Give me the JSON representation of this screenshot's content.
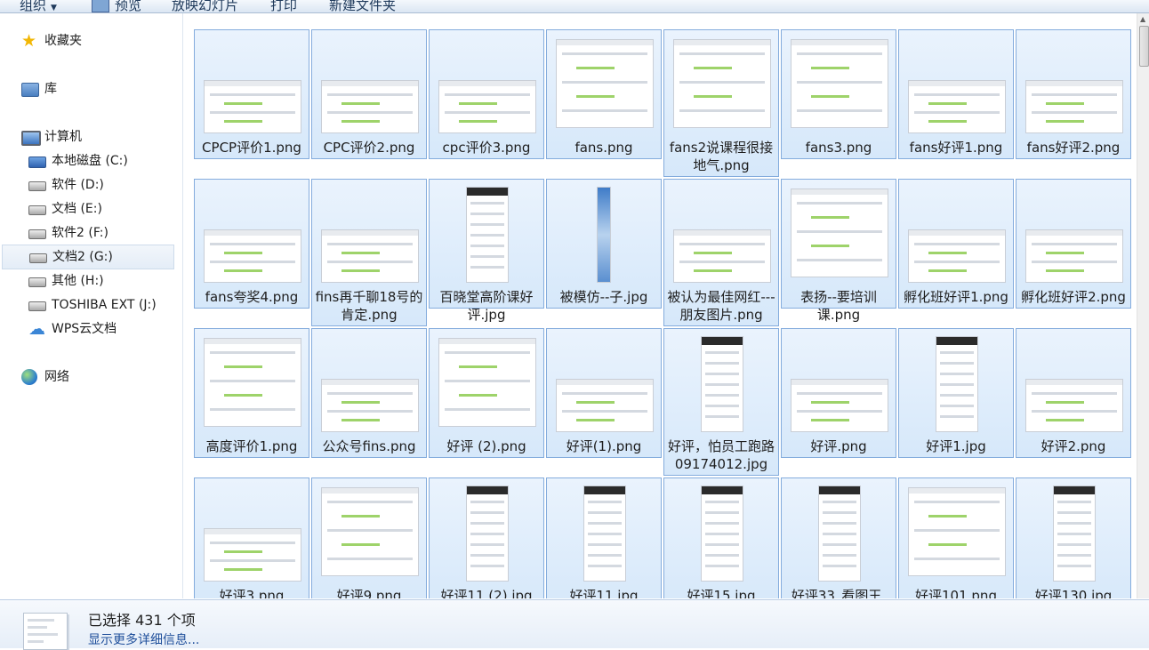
{
  "toolbar": {
    "organize": "组织",
    "preview": "预览",
    "slideshow": "放映幻灯片",
    "print": "打印",
    "new_folder": "新建文件夹"
  },
  "nav": {
    "favorites": "收藏夹",
    "libraries": "库",
    "computer": "计算机",
    "drives": [
      {
        "label": "本地磁盘 (C:)",
        "icon": "system-drive-icon"
      },
      {
        "label": "软件 (D:)",
        "icon": "drive-icon"
      },
      {
        "label": "文档 (E:)",
        "icon": "drive-icon"
      },
      {
        "label": "软件2 (F:)",
        "icon": "drive-icon"
      },
      {
        "label": "文档2 (G:)",
        "icon": "drive-icon",
        "selected": true
      },
      {
        "label": "其他 (H:)",
        "icon": "drive-icon"
      },
      {
        "label": "TOSHIBA EXT (J:)",
        "icon": "drive-icon"
      },
      {
        "label": "WPS云文档",
        "icon": "cloud-icon"
      }
    ],
    "network": "网络"
  },
  "files": [
    {
      "name": "CPCP评价1.png",
      "kind": "wide"
    },
    {
      "name": "CPC评价2.png",
      "kind": "wide"
    },
    {
      "name": "cpc评价3.png",
      "kind": "wide"
    },
    {
      "name": "fans.png",
      "kind": "chat"
    },
    {
      "name": "fans2说课程很接地气.png",
      "kind": "chat"
    },
    {
      "name": "fans3.png",
      "kind": "chat"
    },
    {
      "name": "fans好评1.png",
      "kind": "wide"
    },
    {
      "name": "fans好评2.png",
      "kind": "wide"
    },
    {
      "name": "fans夸奖4.png",
      "kind": "wide"
    },
    {
      "name": "fins再千聊18号的肯定.png",
      "kind": "wide"
    },
    {
      "name": "百晓堂高阶课好评.jpg",
      "kind": "phone"
    },
    {
      "name": "被模仿--子.jpg",
      "kind": "strip"
    },
    {
      "name": "被认为最佳网红---朋友图片.png",
      "kind": "wide"
    },
    {
      "name": "表扬--要培训课.png",
      "kind": "chat"
    },
    {
      "name": "孵化班好评1.png",
      "kind": "wide"
    },
    {
      "name": "孵化班好评2.png",
      "kind": "wide"
    },
    {
      "name": "高度评价1.png",
      "kind": "chat"
    },
    {
      "name": "公众号fins.png",
      "kind": "wide"
    },
    {
      "name": "好评 (2).png",
      "kind": "chat"
    },
    {
      "name": "好评(1).png",
      "kind": "wide"
    },
    {
      "name": "好评，怕员工跑路09174012.jpg",
      "kind": "phone"
    },
    {
      "name": "好评.png",
      "kind": "wide"
    },
    {
      "name": "好评1.jpg",
      "kind": "phone"
    },
    {
      "name": "好评2.png",
      "kind": "wide"
    },
    {
      "name": "好评3.png",
      "kind": "wide"
    },
    {
      "name": "好评9.png",
      "kind": "chat"
    },
    {
      "name": "好评11 (2).jpg",
      "kind": "phone"
    },
    {
      "name": "好评11.jpg",
      "kind": "phone"
    },
    {
      "name": "好评15.jpg",
      "kind": "phone"
    },
    {
      "name": "好评33_看图王.",
      "kind": "phone"
    },
    {
      "name": "好评101.png",
      "kind": "chat"
    },
    {
      "name": "好评130.jpg",
      "kind": "phone"
    }
  ],
  "details": {
    "selected_text": "已选择 431 个项",
    "more_link": "显示更多详细信息..."
  },
  "colors": {
    "selection_fill": "#dbeafa",
    "selection_border": "#84acdd",
    "link": "#1f4f9b"
  }
}
